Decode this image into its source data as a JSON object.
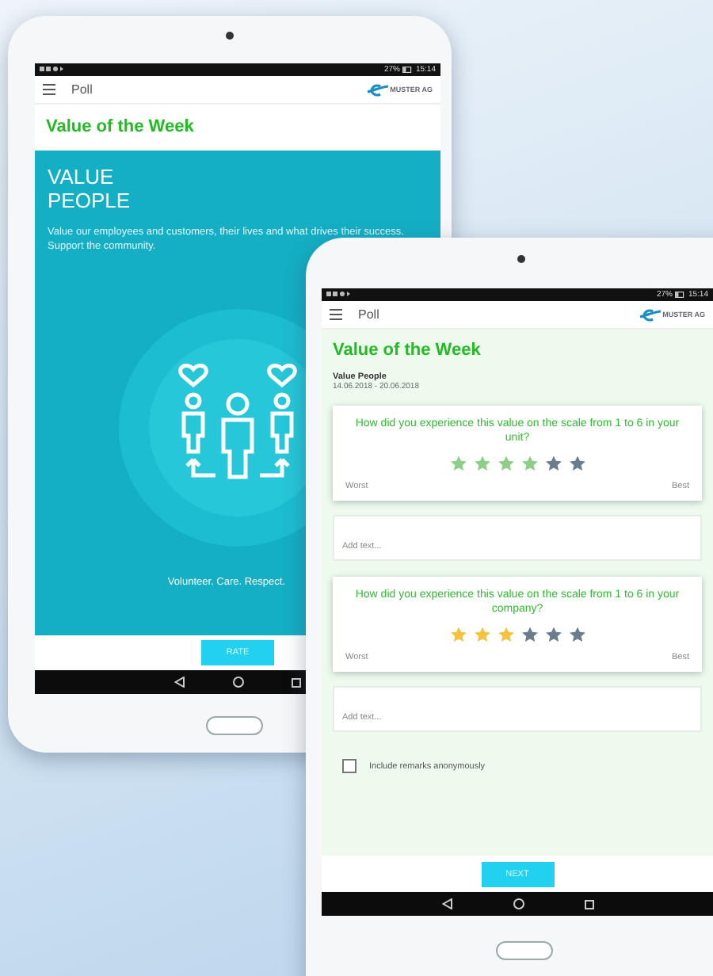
{
  "intro_screen": {
    "status_bar": {
      "battery": "27%",
      "time": "15:14"
    },
    "app_bar": {
      "title": "Poll",
      "logo": "MUSTER AG"
    },
    "header": "Value of the Week",
    "heading": "VALUE PEOPLE",
    "description": "Value our employees and customers, their lives and what drives their success. Support the community.",
    "motto": "Volunteer. Care. Respect.",
    "button": "RATE"
  },
  "poll_screen": {
    "status_bar": {
      "battery": "27%",
      "time": "15:14"
    },
    "app_bar": {
      "title": "Poll",
      "logo": "MUSTER AG"
    },
    "header": "Value of the Week",
    "value_name": "Value People",
    "period": "14.06.2018 - 20.06.2018",
    "questions": [
      {
        "question": "How did you experience this value on the scale from 1 to 6 in your unit?",
        "stars": 4,
        "color": "#8dcf86",
        "low_label": "Worst",
        "high_label": "Best",
        "comment_placeholder": "Add text..."
      },
      {
        "question": "How did you experience this value on the scale from 1 to 6 in your company?",
        "stars": 3,
        "color": "#f4c23c",
        "low_label": "Worst",
        "high_label": "Best",
        "comment_placeholder": "Add text..."
      }
    ],
    "anonymous": {
      "label": "Include remarks anonymously",
      "checked": false
    },
    "button": "NEXT"
  }
}
